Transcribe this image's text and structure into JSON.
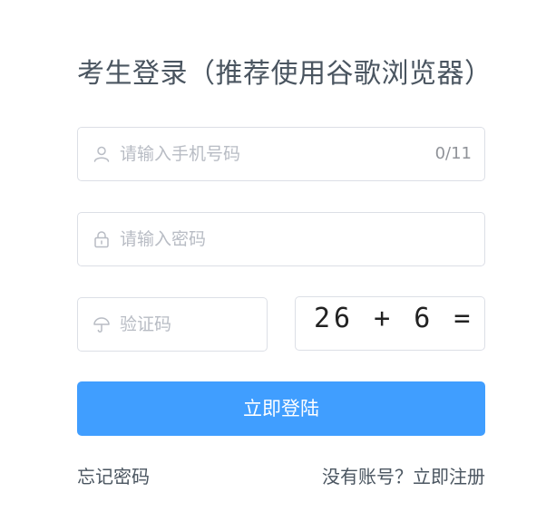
{
  "title": "考生登录（推荐使用谷歌浏览器）",
  "phone": {
    "placeholder": "请输入手机号码",
    "counter": "0/11",
    "icon": "user-icon"
  },
  "password": {
    "placeholder": "请输入密码",
    "icon": "lock-icon"
  },
  "captcha": {
    "placeholder": "验证码",
    "icon": "umbrella-icon",
    "image_text": "26 + 6 ="
  },
  "login_button": "立即登陆",
  "forgot_link": "忘记密码",
  "register_link": "没有账号？立即注册",
  "colors": {
    "primary": "#409eff",
    "border": "#dcdfe6",
    "placeholder": "#b8bcc4",
    "text": "#4a5560"
  }
}
